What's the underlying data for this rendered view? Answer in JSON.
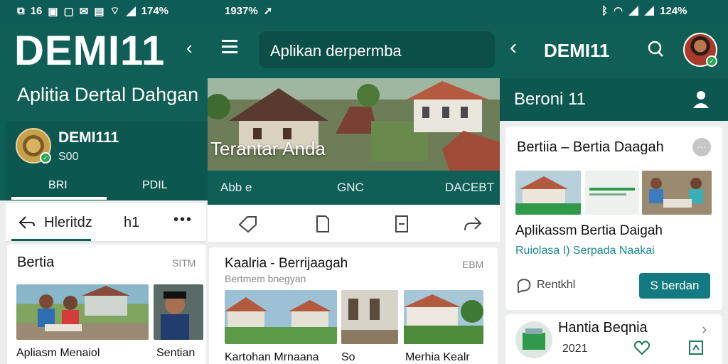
{
  "status": {
    "left_icons": [
      "notification-icon",
      "message-icon",
      "photo-icon",
      "mail-icon",
      "gallery-icon",
      "wifi-icon"
    ],
    "left_text": "16",
    "mid_battery": "174%",
    "time": "1937%",
    "right_battery": "124%"
  },
  "panel1": {
    "brand": "DEMI11",
    "subtitle": "Aplitia Dertal Dahgan",
    "account": {
      "name": "DEMI111",
      "sub": "S00",
      "tabs": [
        "BRI",
        "PDIL"
      ]
    },
    "tabs": [
      "Hleritdz",
      "h1"
    ],
    "card": {
      "title": "Bertia",
      "meta": "SITM",
      "captions": [
        "Apliasm Menaiol",
        "Sentian"
      ]
    }
  },
  "panel2": {
    "search_text": "Aplikan derpermba",
    "hero_title": "Terantar Anda",
    "tabs": [
      "Abb e",
      "GNC",
      "DACEBT"
    ],
    "card": {
      "title": "Kaalria - Berrijaagah",
      "subtitle": "Bertmem bnegyan",
      "meta": "EBM",
      "captions": [
        "Kartohan Mrnaana",
        "So",
        "Merhia Kealr"
      ]
    }
  },
  "panel3": {
    "brand": "DEMI11",
    "section": "Beroni 11",
    "card": {
      "title": "Bertiia – Bertia Daagah",
      "name": "Aplikassm Bertia Daigah",
      "link": "Ruiolasa I) Serpada Naakai",
      "action": "Rentkhl",
      "button": "S berdan"
    },
    "next": {
      "title": "Hantia Beqnia",
      "year": "2021"
    }
  },
  "colors": {
    "primary": "#0f5f57",
    "accent": "#127a80",
    "badge": "#2fa550"
  }
}
